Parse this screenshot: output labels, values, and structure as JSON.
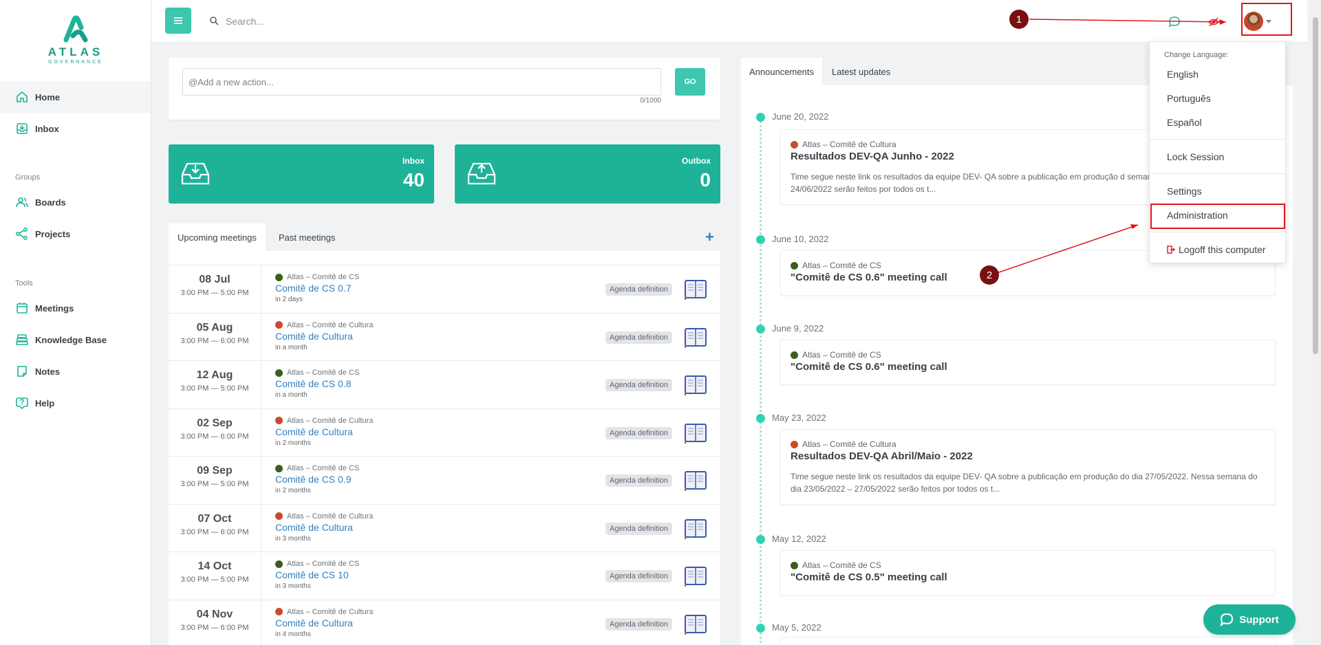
{
  "brand": {
    "name": "ATLAS",
    "tagline": "GOVERNANCE",
    "accent": "#1eb399"
  },
  "sidebar": {
    "main": [
      {
        "label": "Home",
        "icon": "home-icon",
        "active": true
      },
      {
        "label": "Inbox",
        "icon": "inbox-icon"
      }
    ],
    "groups_title": "Groups",
    "groups": [
      {
        "label": "Boards",
        "icon": "users-icon"
      },
      {
        "label": "Projects",
        "icon": "share-icon"
      }
    ],
    "tools_title": "Tools",
    "tools": [
      {
        "label": "Meetings",
        "icon": "calendar-icon"
      },
      {
        "label": "Knowledge Base",
        "icon": "layers-icon"
      },
      {
        "label": "Notes",
        "icon": "note-icon"
      },
      {
        "label": "Help",
        "icon": "help-icon"
      }
    ]
  },
  "topbar": {
    "search_placeholder": "Search...",
    "menu_icon": "hamburger-icon"
  },
  "action": {
    "placeholder": "@Add a new action...",
    "counter": "0/1000",
    "go_label": "GO"
  },
  "inbox": {
    "label": "Inbox",
    "count": "40"
  },
  "outbox": {
    "label": "Outbox",
    "count": "0"
  },
  "meetings": {
    "tabs": [
      "Upcoming meetings",
      "Past meetings"
    ],
    "add_label": "+",
    "rows": [
      {
        "day": "08 Jul",
        "time": "3:00 PM — 5:00 PM",
        "group": "Atlas – Comitê de CS",
        "group_color": "#3b5e1a",
        "title": "Comitê de CS 0.7",
        "relative": "in 2 days",
        "status": "Agenda definition"
      },
      {
        "day": "05 Aug",
        "time": "3:00 PM — 6:00 PM",
        "group": "Atlas – Comitê de Cultura",
        "group_color": "#cc4a2c",
        "title": "Comitê de Cultura",
        "relative": "in a month",
        "status": "Agenda definition"
      },
      {
        "day": "12 Aug",
        "time": "3:00 PM — 5:00 PM",
        "group": "Atlas – Comitê de CS",
        "group_color": "#3b5e1a",
        "title": "Comitê de CS 0.8",
        "relative": "in a month",
        "status": "Agenda definition"
      },
      {
        "day": "02 Sep",
        "time": "3:00 PM — 6:00 PM",
        "group": "Atlas – Comitê de Cultura",
        "group_color": "#cc4a2c",
        "title": "Comitê de Cultura",
        "relative": "in 2 months",
        "status": "Agenda definition"
      },
      {
        "day": "09 Sep",
        "time": "3:00 PM — 5:00 PM",
        "group": "Atlas – Comitê de CS",
        "group_color": "#3b5e1a",
        "title": "Comitê de CS 0.9",
        "relative": "in 2 months",
        "status": "Agenda definition"
      },
      {
        "day": "07 Oct",
        "time": "3:00 PM — 6:00 PM",
        "group": "Atlas – Comitê de Cultura",
        "group_color": "#cc4a2c",
        "title": "Comitê de Cultura",
        "relative": "in 3 months",
        "status": "Agenda definition"
      },
      {
        "day": "14 Oct",
        "time": "3:00 PM — 5:00 PM",
        "group": "Atlas – Comitê de CS",
        "group_color": "#3b5e1a",
        "title": "Comitê de CS 10",
        "relative": "in 3 months",
        "status": "Agenda definition"
      },
      {
        "day": "04 Nov",
        "time": "3:00 PM — 6:00 PM",
        "group": "Atlas – Comitê de Cultura",
        "group_color": "#cc4a2c",
        "title": "Comitê de Cultura",
        "relative": "in 4 months",
        "status": "Agenda definition"
      }
    ]
  },
  "announcements": {
    "tabs": [
      "Announcements",
      "Latest updates"
    ],
    "posts": [
      {
        "date": "June 20, 2022",
        "group": "Atlas – Comitê de Cultura",
        "group_color": "#cc4a2c",
        "title": "Resultados DEV-QA Junho - 2022",
        "body": "Time segue neste link os resultados da equipe DEV- QA sobre a publicação em produção d semana do dia 20/06/2022 – 24/06/2022 serão feitos por todos os t..."
      },
      {
        "date": "June 10, 2022",
        "group": "Atlas – Comitê de CS",
        "group_color": "#3b5e1a",
        "title": "\"Comitê de CS 0.6\" meeting call",
        "body": ""
      },
      {
        "date": "June 9, 2022",
        "group": "Atlas – Comitê de CS",
        "group_color": "#3b5e1a",
        "title": "\"Comitê de CS 0.6\" meeting call",
        "body": ""
      },
      {
        "date": "May 23, 2022",
        "group": "Atlas – Comitê de Cultura",
        "group_color": "#cc4a2c",
        "title": "Resultados DEV-QA Abril/Maio - 2022",
        "body": "Time segue neste link os resultados da equipe DEV- QA sobre a publicação em produção do dia 27/05/2022. Nessa semana do dia 23/05/2022 – 27/05/2022 serão feitos por todos os t..."
      },
      {
        "date": "May 12, 2022",
        "group": "Atlas – Comitê de CS",
        "group_color": "#3b5e1a",
        "title": "\"Comitê de CS 0.5\" meeting call",
        "body": ""
      },
      {
        "date": "May 5, 2022",
        "group": "",
        "group_color": "",
        "title": "",
        "body": ""
      }
    ]
  },
  "user_menu": {
    "language_header": "Change Language:",
    "languages": [
      "English",
      "Português",
      "Español"
    ],
    "lock": "Lock Session",
    "settings": "Settings",
    "administration": "Administration",
    "logoff": "Logoff this computer"
  },
  "annotations": {
    "step1": "1",
    "step2": "2",
    "color": "#e2141c"
  },
  "support": {
    "label": "Support"
  }
}
